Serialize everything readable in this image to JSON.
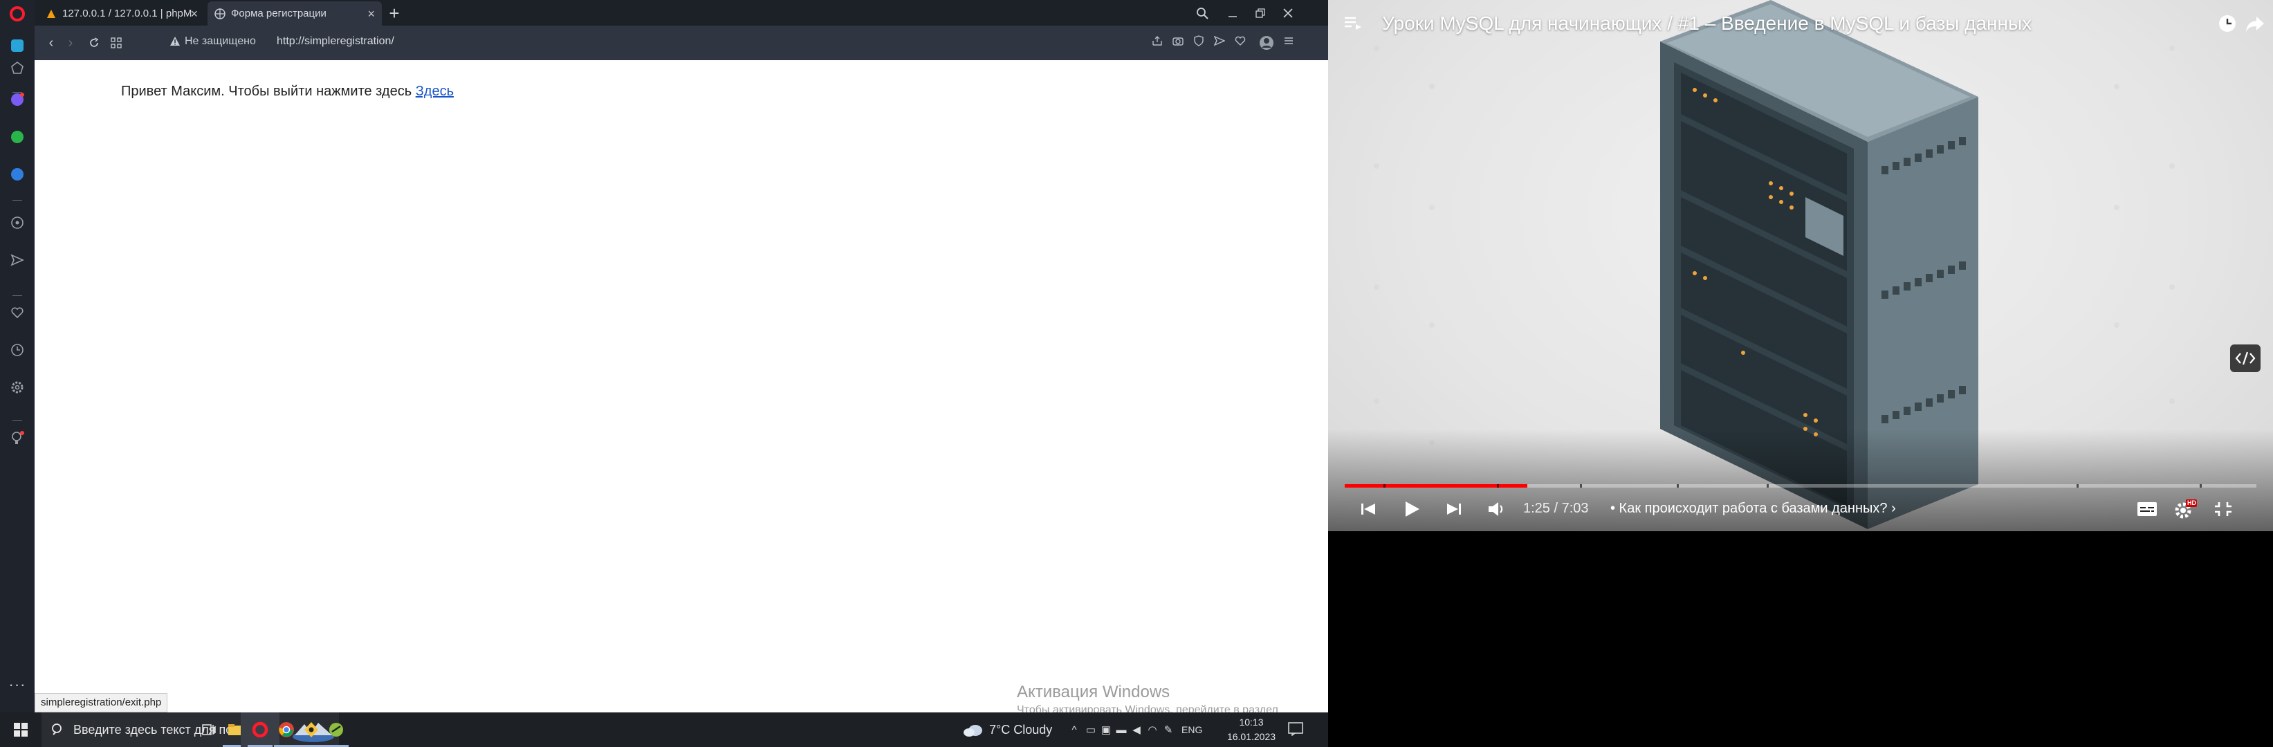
{
  "browser": {
    "tabs": [
      {
        "label": "127.0.0.1 / 127.0.0.1 | phpM",
        "close": "×"
      },
      {
        "label": "Форма регистрации",
        "close": "×"
      }
    ],
    "new_tab": "+",
    "security_label": "Не защищено",
    "url": "http://simpleregistration/",
    "page": {
      "greeting": "Привет Максим. Чтобы выйти нажмите здесь",
      "link": "Здесь"
    },
    "status_url": "simpleregistration/exit.php",
    "activation": {
      "title": "Активация Windows",
      "subtitle": "Чтобы активировать Windows, перейдите в раздел \"Параметры\"."
    }
  },
  "taskbar": {
    "search_placeholder": "Введите здесь текст для поиска",
    "weather": "7°C  Cloudy",
    "language": "ENG",
    "time": "10:13",
    "date": "16.01.2023"
  },
  "video": {
    "title": "Уроки MySQL для начинающих / #1 – Введение в MySQL и базы данных",
    "time": "1:25 / 7:03",
    "chapter": "• Как происходит работа с базами данных? ›",
    "progress": 0.2,
    "hd_badge": "HD",
    "colors": {
      "accent": "#ff0000",
      "sidebar": "#1f242c",
      "tabbar": "#1c2027"
    }
  }
}
